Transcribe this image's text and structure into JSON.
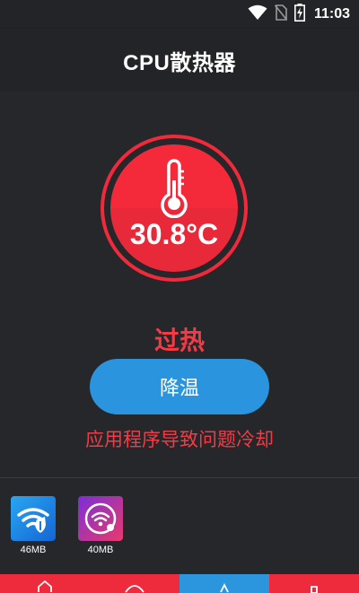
{
  "status_bar": {
    "time": "11:03",
    "icons": [
      "wifi-icon",
      "no-sim-icon",
      "battery-charging-icon"
    ]
  },
  "header": {
    "title": "CPU散热器"
  },
  "gauge": {
    "temperature": "30.8°C",
    "icon": "thermometer-icon",
    "color": "#f42a3a"
  },
  "status": {
    "label": "过热",
    "color": "#f23b45"
  },
  "cool_button": {
    "label": "降温",
    "color": "#2a95de"
  },
  "cause_text": "应用程序导致问题冷却",
  "apps": [
    {
      "icon": "wifi-shield-app-icon",
      "size": "46MB"
    },
    {
      "icon": "wifi-circle-app-icon",
      "size": "40MB"
    }
  ],
  "bottom_nav": {
    "items": [
      {
        "icon": "home-icon",
        "active": false
      },
      {
        "icon": "speed-icon",
        "active": false
      },
      {
        "icon": "cooler-icon",
        "active": true
      },
      {
        "icon": "tools-icon",
        "active": false
      }
    ]
  }
}
